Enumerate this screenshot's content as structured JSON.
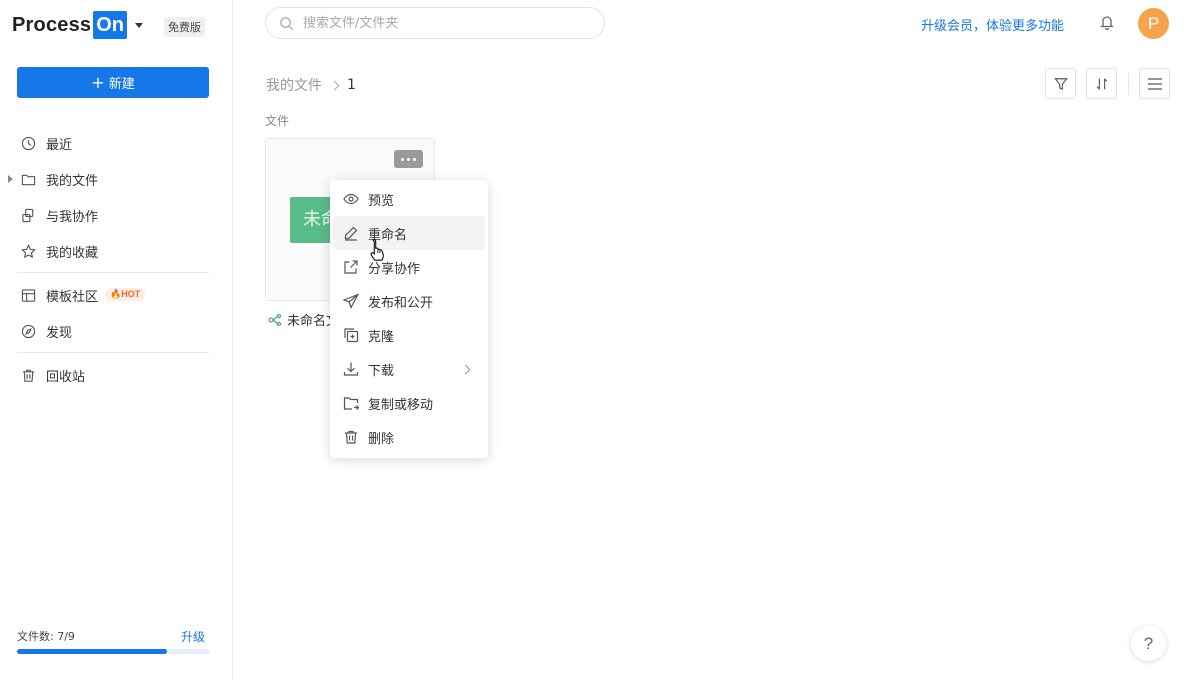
{
  "brand": {
    "name": "Process",
    "highlight": "On",
    "plan_badge": "免费版",
    "accent": "#1677e8"
  },
  "sidebar": {
    "new_button": "新建",
    "items": [
      {
        "label": "最近",
        "icon": "clock-icon"
      },
      {
        "label": "我的文件",
        "icon": "folder-icon",
        "expandable": true
      },
      {
        "label": "与我协作",
        "icon": "collaborate-icon"
      },
      {
        "label": "我的收藏",
        "icon": "star-icon"
      },
      {
        "label": "模板社区",
        "icon": "template-icon",
        "badge": "HOT"
      },
      {
        "label": "发现",
        "icon": "compass-icon"
      },
      {
        "label": "回收站",
        "icon": "trash-icon"
      }
    ],
    "quota": {
      "label": "文件数: 7/9",
      "used": 7,
      "total": 9,
      "upgrade": "升级"
    }
  },
  "header": {
    "search_placeholder": "搜索文件/文件夹",
    "upgrade_text": "升级会员，体验更多功能",
    "avatar_letter": "P",
    "avatar_color": "#f6a34c"
  },
  "breadcrumb": {
    "root": "我的文件",
    "current": "1"
  },
  "content": {
    "section_label": "文件",
    "files": [
      {
        "thumb_text": "未命",
        "name": "未命名文"
      }
    ]
  },
  "context_menu": {
    "items": [
      {
        "label": "预览",
        "icon": "eye-icon"
      },
      {
        "label": "重命名",
        "icon": "edit-icon",
        "active": true
      },
      {
        "label": "分享协作",
        "icon": "share-icon"
      },
      {
        "label": "发布和公开",
        "icon": "send-icon"
      },
      {
        "label": "克隆",
        "icon": "clone-icon"
      },
      {
        "label": "下载",
        "icon": "download-icon",
        "submenu": true
      },
      {
        "label": "复制或移动",
        "icon": "move-icon"
      },
      {
        "label": "删除",
        "icon": "trash-icon"
      }
    ]
  },
  "help": "?"
}
